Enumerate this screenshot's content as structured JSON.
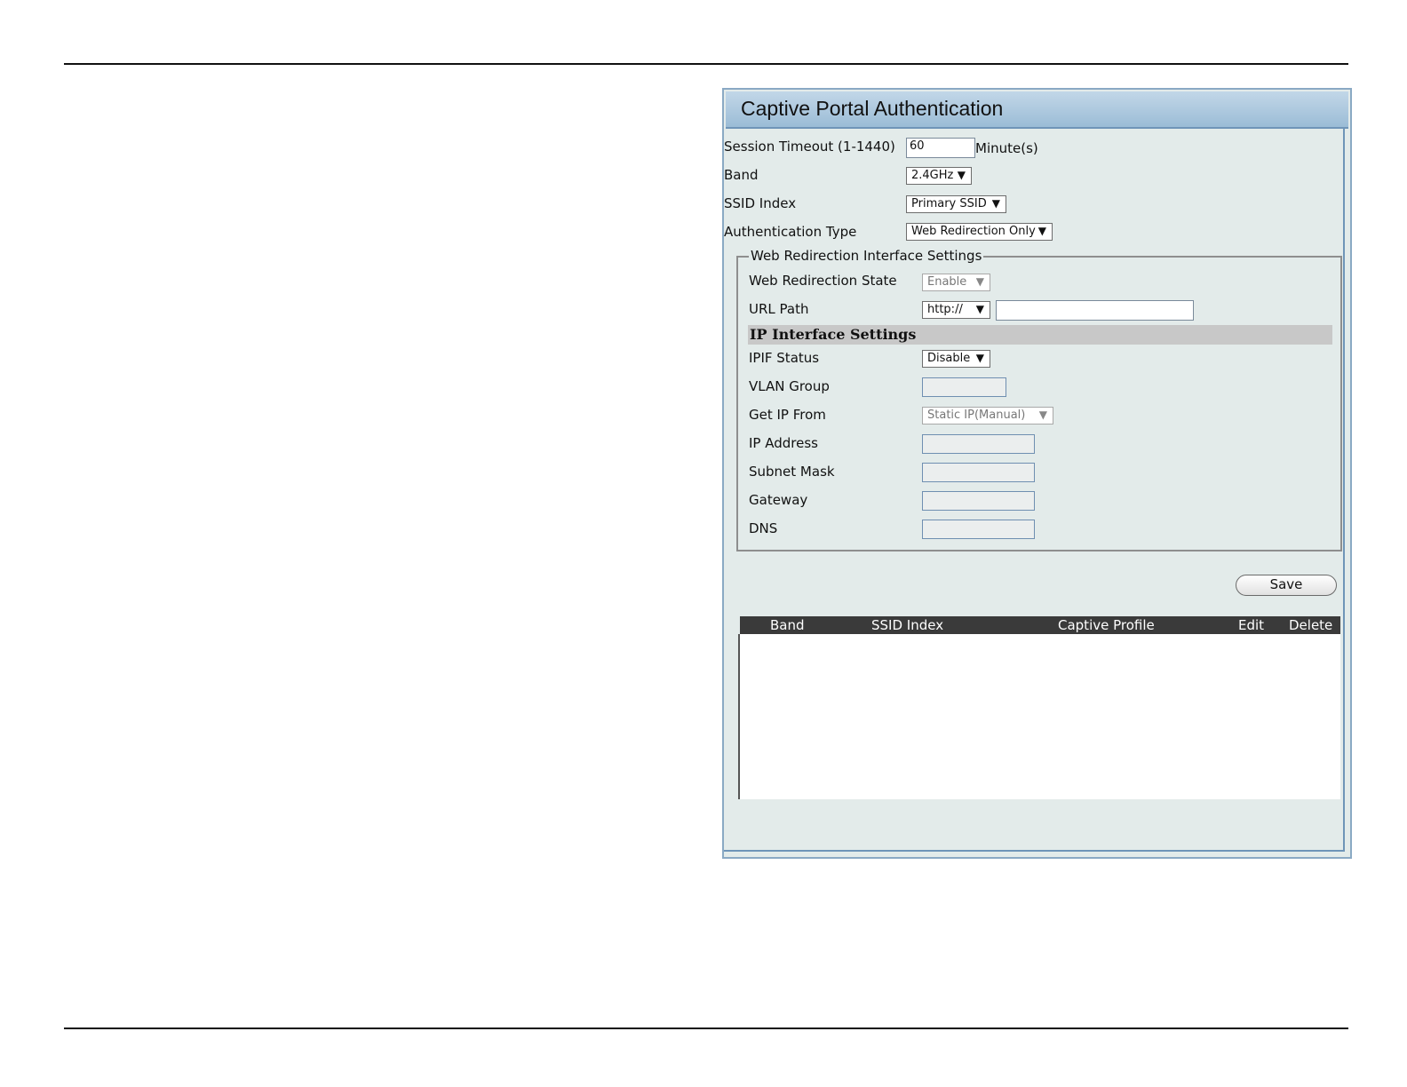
{
  "panel": {
    "title": "Captive Portal Authentication"
  },
  "form": {
    "session_timeout_label": "Session Timeout (1-1440)",
    "session_timeout_value": "60",
    "session_timeout_unit": "Minute(s)",
    "band_label": "Band",
    "band_value": "2.4GHz",
    "ssid_index_label": "SSID Index",
    "ssid_index_value": "Primary SSID",
    "auth_type_label": "Authentication Type",
    "auth_type_value": "Web Redirection Only"
  },
  "web_redirection": {
    "legend": "Web Redirection Interface Settings",
    "state_label": "Web Redirection State",
    "state_value": "Enable",
    "url_path_label": "URL Path",
    "url_scheme_value": "http://",
    "url_value": ""
  },
  "ip_interface": {
    "section_title": "IP Interface Settings",
    "ipif_status_label": "IPIF Status",
    "ipif_status_value": "Disable",
    "vlan_group_label": "VLAN Group",
    "get_ip_from_label": "Get IP From",
    "get_ip_from_value": "Static IP(Manual)",
    "ip_address_label": "IP Address",
    "subnet_mask_label": "Subnet Mask",
    "gateway_label": "Gateway",
    "dns_label": "DNS"
  },
  "actions": {
    "save_label": "Save"
  },
  "table": {
    "columns": [
      "Band",
      "SSID Index",
      "Captive Profile",
      "Edit",
      "Delete"
    ],
    "rows": []
  },
  "icons": {
    "dropdown_arrow": "▼"
  }
}
